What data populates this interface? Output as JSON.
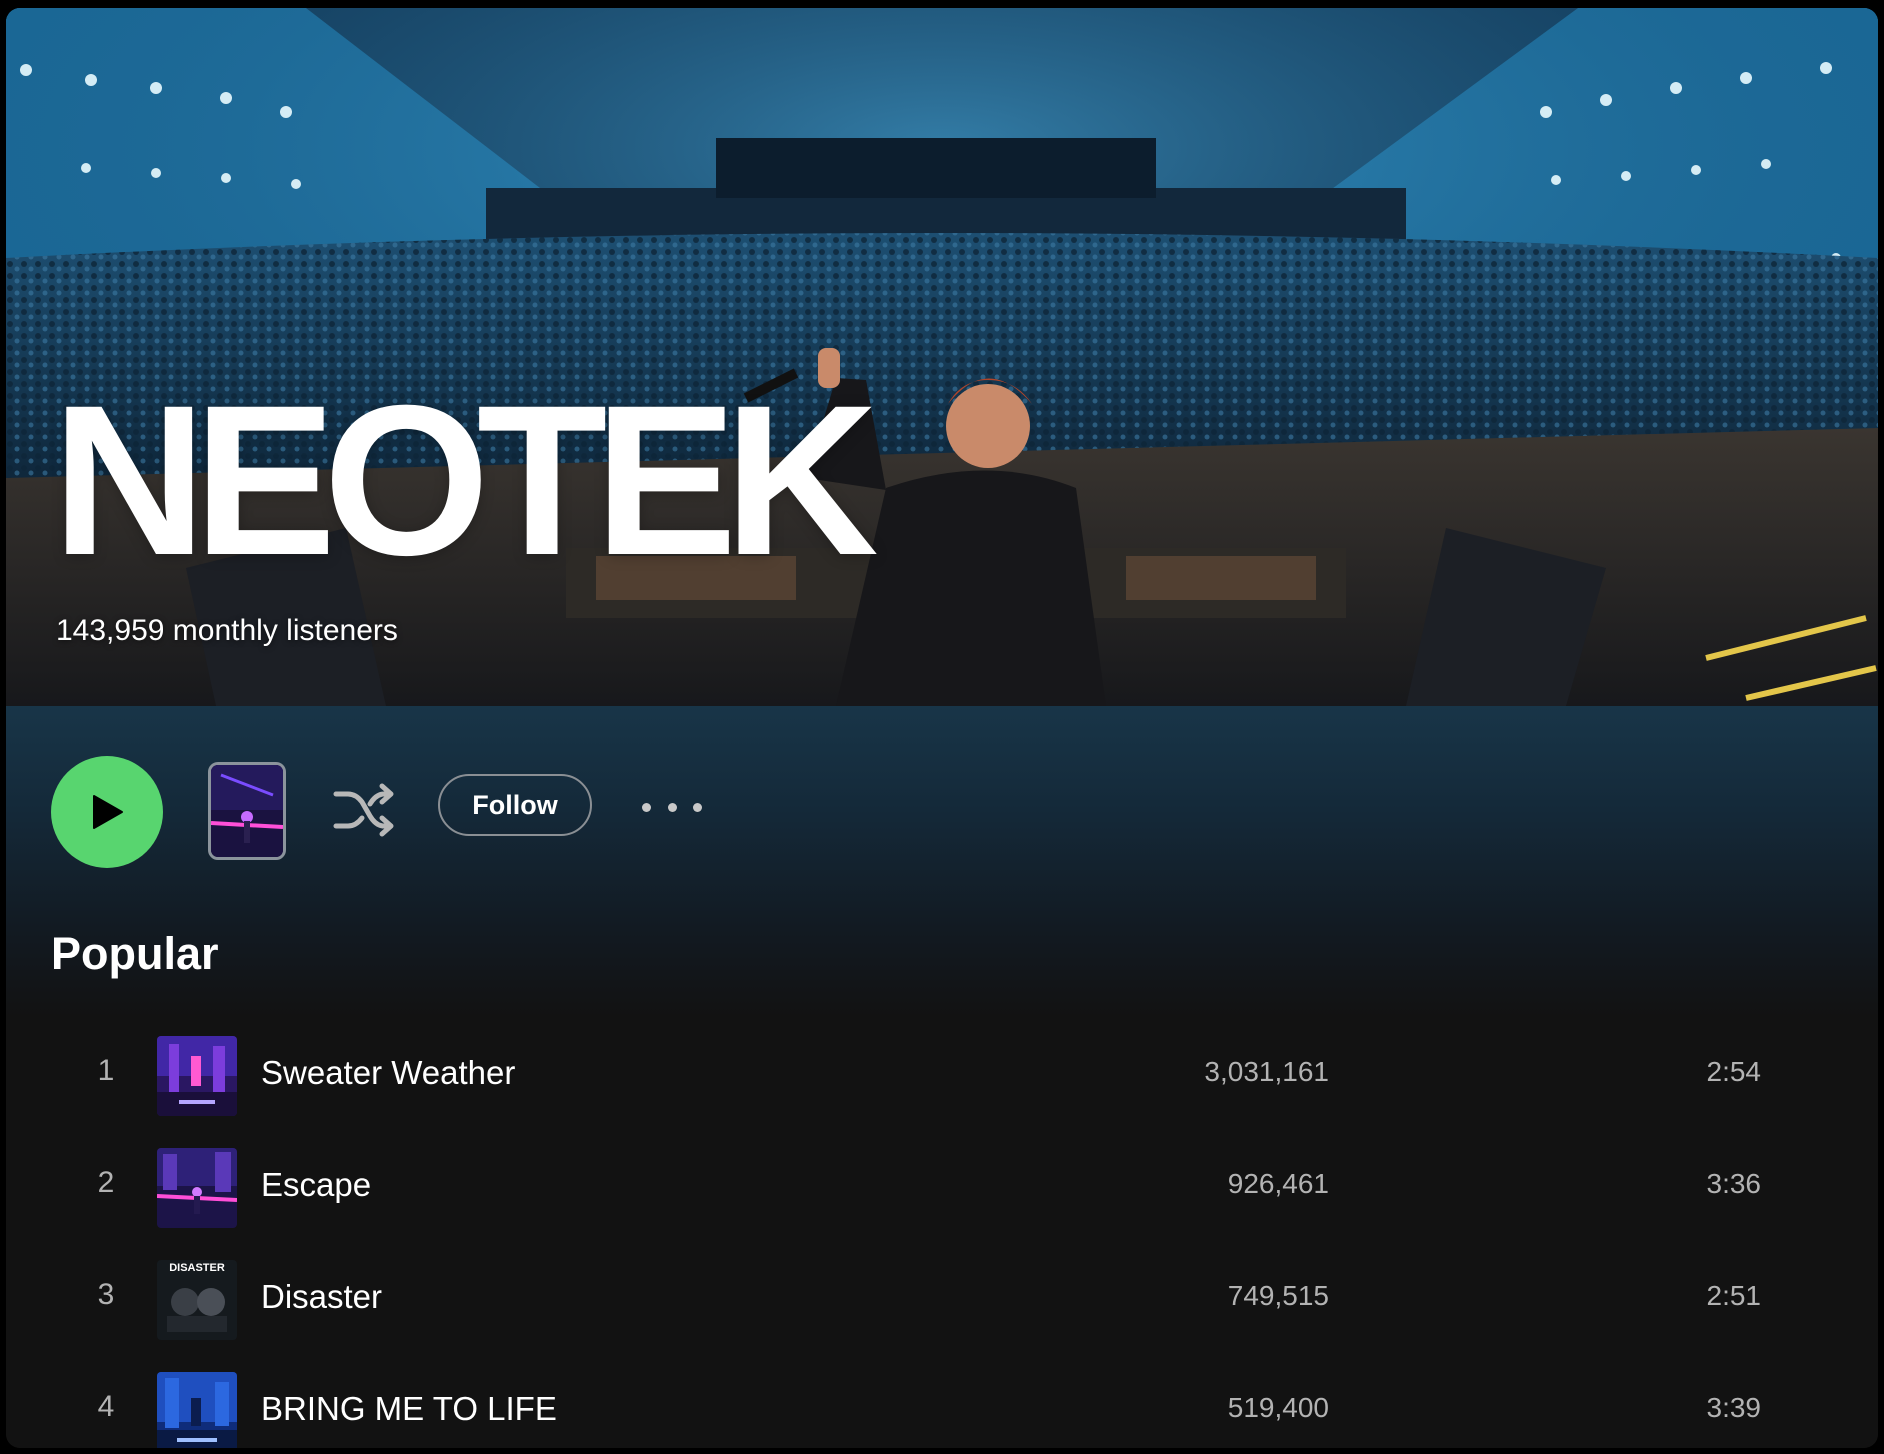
{
  "artist": {
    "name": "NEOTEK",
    "monthly_listeners": "143,959 monthly listeners"
  },
  "actions": {
    "play_icon": "play-icon",
    "shuffle_icon": "shuffle-icon",
    "follow_label": "Follow",
    "more_icon": "more-options-icon"
  },
  "popular": {
    "title": "Popular",
    "tracks": [
      {
        "index": "1",
        "title": "Sweater Weather",
        "plays": "3,031,161",
        "duration": "2:54"
      },
      {
        "index": "2",
        "title": "Escape",
        "plays": "926,461",
        "duration": "3:36"
      },
      {
        "index": "3",
        "title": "Disaster",
        "plays": "749,515",
        "duration": "2:51",
        "cover_text": "DISASTER"
      },
      {
        "index": "4",
        "title": "BRING ME TO LIFE",
        "plays": "519,400",
        "duration": "3:39"
      }
    ]
  },
  "colors": {
    "play_button": "#58d56f",
    "background": "#121212",
    "hero_tint": "#1a6c9e"
  }
}
